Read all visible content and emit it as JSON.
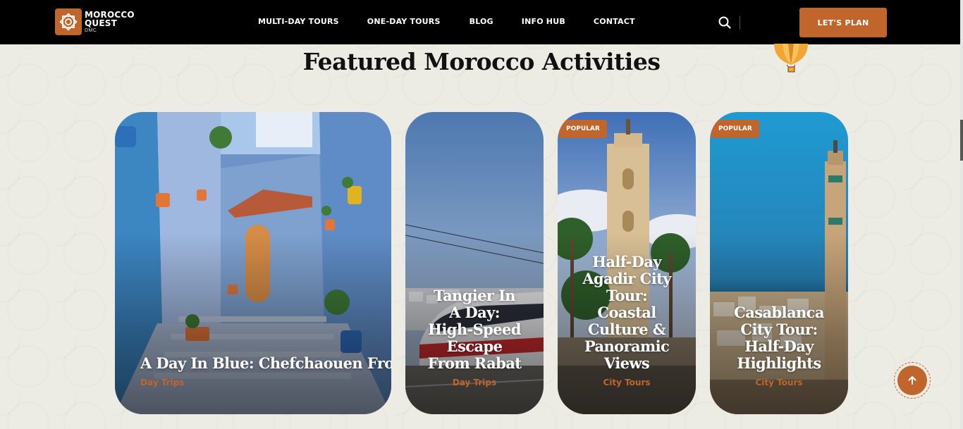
{
  "brand": {
    "line1": "MOROCCO",
    "line2": "QUEST",
    "line3": "DMC",
    "color": "#c0652b"
  },
  "nav": {
    "links": [
      "MULTI-DAY TOURS",
      "ONE-DAY TOURS",
      "BLOG",
      "INFO HUB",
      "CONTACT"
    ],
    "search_icon": "search-icon",
    "cta_label": "LET'S PLAN"
  },
  "section": {
    "title": "Featured Morocco Activities"
  },
  "cards": [
    {
      "title": "A Day In Blue: Chefchaouen From",
      "category": "Day Trips",
      "badge": ""
    },
    {
      "title": "Tangier In A Day: High-Speed Escape From Rabat",
      "category": "Day Trips",
      "badge": ""
    },
    {
      "title": "Half-Day Agadir City Tour: Coastal Culture & Panoramic Views",
      "category": "City Tours",
      "badge": "POPULAR"
    },
    {
      "title": "Casablanca City Tour: Half-Day Highlights",
      "category": "City Tours",
      "badge": "POPULAR"
    }
  ],
  "back_to_top_icon": "arrow-up-icon"
}
